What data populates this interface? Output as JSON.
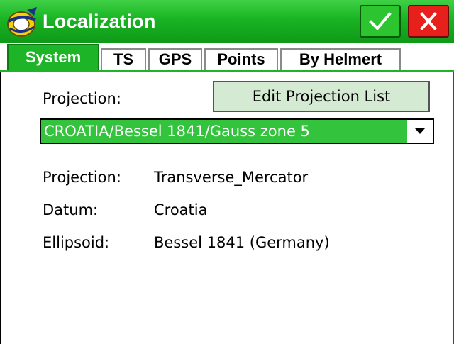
{
  "window": {
    "title": "Localization",
    "ok_icon": "checkmark-icon",
    "close_icon": "close-icon",
    "app_icon": "app-logo-icon"
  },
  "tabs": [
    {
      "label": "System",
      "active": true
    },
    {
      "label": "TS",
      "active": false
    },
    {
      "label": "GPS",
      "active": false
    },
    {
      "label": "Points",
      "active": false
    },
    {
      "label": "By Helmert",
      "active": false
    }
  ],
  "system": {
    "projection_label": "Projection:",
    "edit_button_label": "Edit Projection List",
    "selected_projection": "CROATIA/Bessel 1841/Gauss zone 5",
    "details": [
      {
        "label": "Projection:",
        "value": "Transverse_Mercator"
      },
      {
        "label": "Datum:",
        "value": "Croatia"
      },
      {
        "label": "Ellipsoid:",
        "value": "Bessel 1841 (Germany)"
      }
    ]
  },
  "colors": {
    "accent_green": "#1eb427",
    "close_red": "#e8201c"
  }
}
